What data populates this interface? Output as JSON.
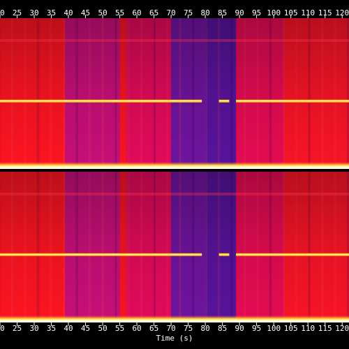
{
  "chart_data": {
    "type": "heatmap",
    "subtype": "spectrogram",
    "channels": 2,
    "xlabel": "Time (s)",
    "xlim": [
      20,
      122
    ],
    "x_ticks": [
      20,
      25,
      30,
      35,
      40,
      45,
      50,
      55,
      60,
      65,
      70,
      75,
      80,
      85,
      90,
      95,
      100,
      105,
      110,
      115,
      120
    ],
    "x_tick_labels": [
      "20",
      "25",
      "30",
      "35",
      "40",
      "45",
      "50",
      "55",
      "60",
      "65",
      "70",
      "75",
      "80",
      "85",
      "90",
      "95",
      "100",
      "105",
      "110",
      "115",
      "120"
    ],
    "tick_axes": [
      "top",
      "bottom"
    ],
    "time_segments": [
      {
        "start": 20,
        "end": 39,
        "intensity": 0.95
      },
      {
        "start": 39,
        "end": 55,
        "intensity": 0.6
      },
      {
        "start": 55,
        "end": 57,
        "intensity": 0.85
      },
      {
        "start": 57,
        "end": 70,
        "intensity": 0.7
      },
      {
        "start": 70,
        "end": 80,
        "intensity": 0.35
      },
      {
        "start": 80,
        "end": 89,
        "intensity": 0.28
      },
      {
        "start": 89,
        "end": 103,
        "intensity": 0.72
      },
      {
        "start": 103,
        "end": 122,
        "intensity": 0.88
      }
    ],
    "harmonic_band": {
      "position_fraction": 0.55,
      "gaps": [
        [
          79,
          84
        ],
        [
          87,
          89
        ]
      ]
    },
    "colormap": [
      "#000000",
      "#3a0078",
      "#8a1ab8",
      "#e8004a",
      "#ff3020",
      "#ffa020",
      "#ffff80",
      "#ffffff"
    ]
  }
}
